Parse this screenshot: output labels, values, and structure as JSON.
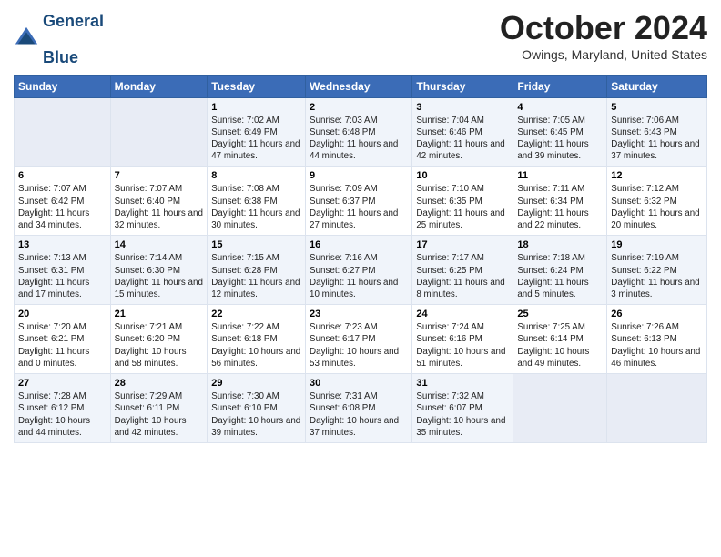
{
  "header": {
    "logo_line1": "General",
    "logo_line2": "Blue",
    "month_title": "October 2024",
    "location": "Owings, Maryland, United States"
  },
  "weekdays": [
    "Sunday",
    "Monday",
    "Tuesday",
    "Wednesday",
    "Thursday",
    "Friday",
    "Saturday"
  ],
  "weeks": [
    [
      {
        "day": "",
        "empty": true
      },
      {
        "day": "",
        "empty": true
      },
      {
        "day": "1",
        "sunrise": "Sunrise: 7:02 AM",
        "sunset": "Sunset: 6:49 PM",
        "daylight": "Daylight: 11 hours and 47 minutes."
      },
      {
        "day": "2",
        "sunrise": "Sunrise: 7:03 AM",
        "sunset": "Sunset: 6:48 PM",
        "daylight": "Daylight: 11 hours and 44 minutes."
      },
      {
        "day": "3",
        "sunrise": "Sunrise: 7:04 AM",
        "sunset": "Sunset: 6:46 PM",
        "daylight": "Daylight: 11 hours and 42 minutes."
      },
      {
        "day": "4",
        "sunrise": "Sunrise: 7:05 AM",
        "sunset": "Sunset: 6:45 PM",
        "daylight": "Daylight: 11 hours and 39 minutes."
      },
      {
        "day": "5",
        "sunrise": "Sunrise: 7:06 AM",
        "sunset": "Sunset: 6:43 PM",
        "daylight": "Daylight: 11 hours and 37 minutes."
      }
    ],
    [
      {
        "day": "6",
        "sunrise": "Sunrise: 7:07 AM",
        "sunset": "Sunset: 6:42 PM",
        "daylight": "Daylight: 11 hours and 34 minutes."
      },
      {
        "day": "7",
        "sunrise": "Sunrise: 7:07 AM",
        "sunset": "Sunset: 6:40 PM",
        "daylight": "Daylight: 11 hours and 32 minutes."
      },
      {
        "day": "8",
        "sunrise": "Sunrise: 7:08 AM",
        "sunset": "Sunset: 6:38 PM",
        "daylight": "Daylight: 11 hours and 30 minutes."
      },
      {
        "day": "9",
        "sunrise": "Sunrise: 7:09 AM",
        "sunset": "Sunset: 6:37 PM",
        "daylight": "Daylight: 11 hours and 27 minutes."
      },
      {
        "day": "10",
        "sunrise": "Sunrise: 7:10 AM",
        "sunset": "Sunset: 6:35 PM",
        "daylight": "Daylight: 11 hours and 25 minutes."
      },
      {
        "day": "11",
        "sunrise": "Sunrise: 7:11 AM",
        "sunset": "Sunset: 6:34 PM",
        "daylight": "Daylight: 11 hours and 22 minutes."
      },
      {
        "day": "12",
        "sunrise": "Sunrise: 7:12 AM",
        "sunset": "Sunset: 6:32 PM",
        "daylight": "Daylight: 11 hours and 20 minutes."
      }
    ],
    [
      {
        "day": "13",
        "sunrise": "Sunrise: 7:13 AM",
        "sunset": "Sunset: 6:31 PM",
        "daylight": "Daylight: 11 hours and 17 minutes."
      },
      {
        "day": "14",
        "sunrise": "Sunrise: 7:14 AM",
        "sunset": "Sunset: 6:30 PM",
        "daylight": "Daylight: 11 hours and 15 minutes."
      },
      {
        "day": "15",
        "sunrise": "Sunrise: 7:15 AM",
        "sunset": "Sunset: 6:28 PM",
        "daylight": "Daylight: 11 hours and 12 minutes."
      },
      {
        "day": "16",
        "sunrise": "Sunrise: 7:16 AM",
        "sunset": "Sunset: 6:27 PM",
        "daylight": "Daylight: 11 hours and 10 minutes."
      },
      {
        "day": "17",
        "sunrise": "Sunrise: 7:17 AM",
        "sunset": "Sunset: 6:25 PM",
        "daylight": "Daylight: 11 hours and 8 minutes."
      },
      {
        "day": "18",
        "sunrise": "Sunrise: 7:18 AM",
        "sunset": "Sunset: 6:24 PM",
        "daylight": "Daylight: 11 hours and 5 minutes."
      },
      {
        "day": "19",
        "sunrise": "Sunrise: 7:19 AM",
        "sunset": "Sunset: 6:22 PM",
        "daylight": "Daylight: 11 hours and 3 minutes."
      }
    ],
    [
      {
        "day": "20",
        "sunrise": "Sunrise: 7:20 AM",
        "sunset": "Sunset: 6:21 PM",
        "daylight": "Daylight: 11 hours and 0 minutes."
      },
      {
        "day": "21",
        "sunrise": "Sunrise: 7:21 AM",
        "sunset": "Sunset: 6:20 PM",
        "daylight": "Daylight: 10 hours and 58 minutes."
      },
      {
        "day": "22",
        "sunrise": "Sunrise: 7:22 AM",
        "sunset": "Sunset: 6:18 PM",
        "daylight": "Daylight: 10 hours and 56 minutes."
      },
      {
        "day": "23",
        "sunrise": "Sunrise: 7:23 AM",
        "sunset": "Sunset: 6:17 PM",
        "daylight": "Daylight: 10 hours and 53 minutes."
      },
      {
        "day": "24",
        "sunrise": "Sunrise: 7:24 AM",
        "sunset": "Sunset: 6:16 PM",
        "daylight": "Daylight: 10 hours and 51 minutes."
      },
      {
        "day": "25",
        "sunrise": "Sunrise: 7:25 AM",
        "sunset": "Sunset: 6:14 PM",
        "daylight": "Daylight: 10 hours and 49 minutes."
      },
      {
        "day": "26",
        "sunrise": "Sunrise: 7:26 AM",
        "sunset": "Sunset: 6:13 PM",
        "daylight": "Daylight: 10 hours and 46 minutes."
      }
    ],
    [
      {
        "day": "27",
        "sunrise": "Sunrise: 7:28 AM",
        "sunset": "Sunset: 6:12 PM",
        "daylight": "Daylight: 10 hours and 44 minutes."
      },
      {
        "day": "28",
        "sunrise": "Sunrise: 7:29 AM",
        "sunset": "Sunset: 6:11 PM",
        "daylight": "Daylight: 10 hours and 42 minutes."
      },
      {
        "day": "29",
        "sunrise": "Sunrise: 7:30 AM",
        "sunset": "Sunset: 6:10 PM",
        "daylight": "Daylight: 10 hours and 39 minutes."
      },
      {
        "day": "30",
        "sunrise": "Sunrise: 7:31 AM",
        "sunset": "Sunset: 6:08 PM",
        "daylight": "Daylight: 10 hours and 37 minutes."
      },
      {
        "day": "31",
        "sunrise": "Sunrise: 7:32 AM",
        "sunset": "Sunset: 6:07 PM",
        "daylight": "Daylight: 10 hours and 35 minutes."
      },
      {
        "day": "",
        "empty": true
      },
      {
        "day": "",
        "empty": true
      }
    ]
  ]
}
